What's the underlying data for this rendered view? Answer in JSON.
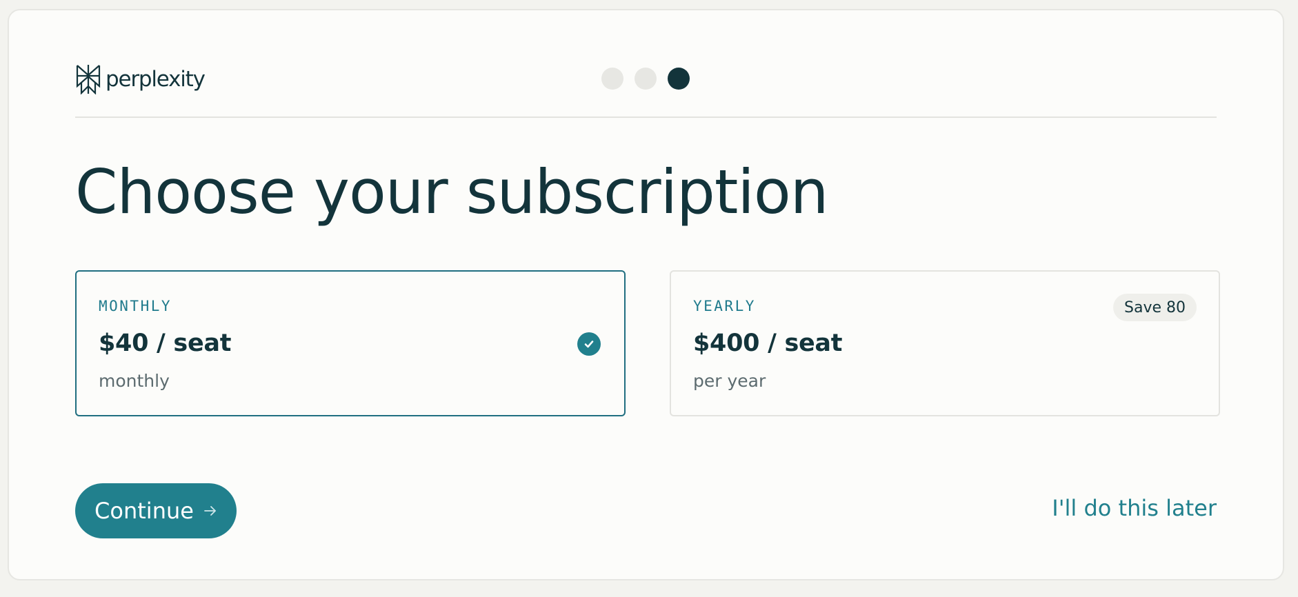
{
  "brand": {
    "name": "perplexity"
  },
  "steps": {
    "total": 3,
    "current": 3
  },
  "page": {
    "title": "Choose your subscription"
  },
  "plans": [
    {
      "label": "MONTHLY",
      "price": "$40 / seat",
      "period": "monthly",
      "selected": true
    },
    {
      "label": "YEARLY",
      "price": "$400 / seat",
      "period": "per year",
      "badge": "Save 80",
      "selected": false
    }
  ],
  "actions": {
    "continue_label": "Continue",
    "later_label": "I'll do this later"
  },
  "colors": {
    "accent": "#21808d",
    "text": "#13343b",
    "background": "#fcfcfa"
  }
}
